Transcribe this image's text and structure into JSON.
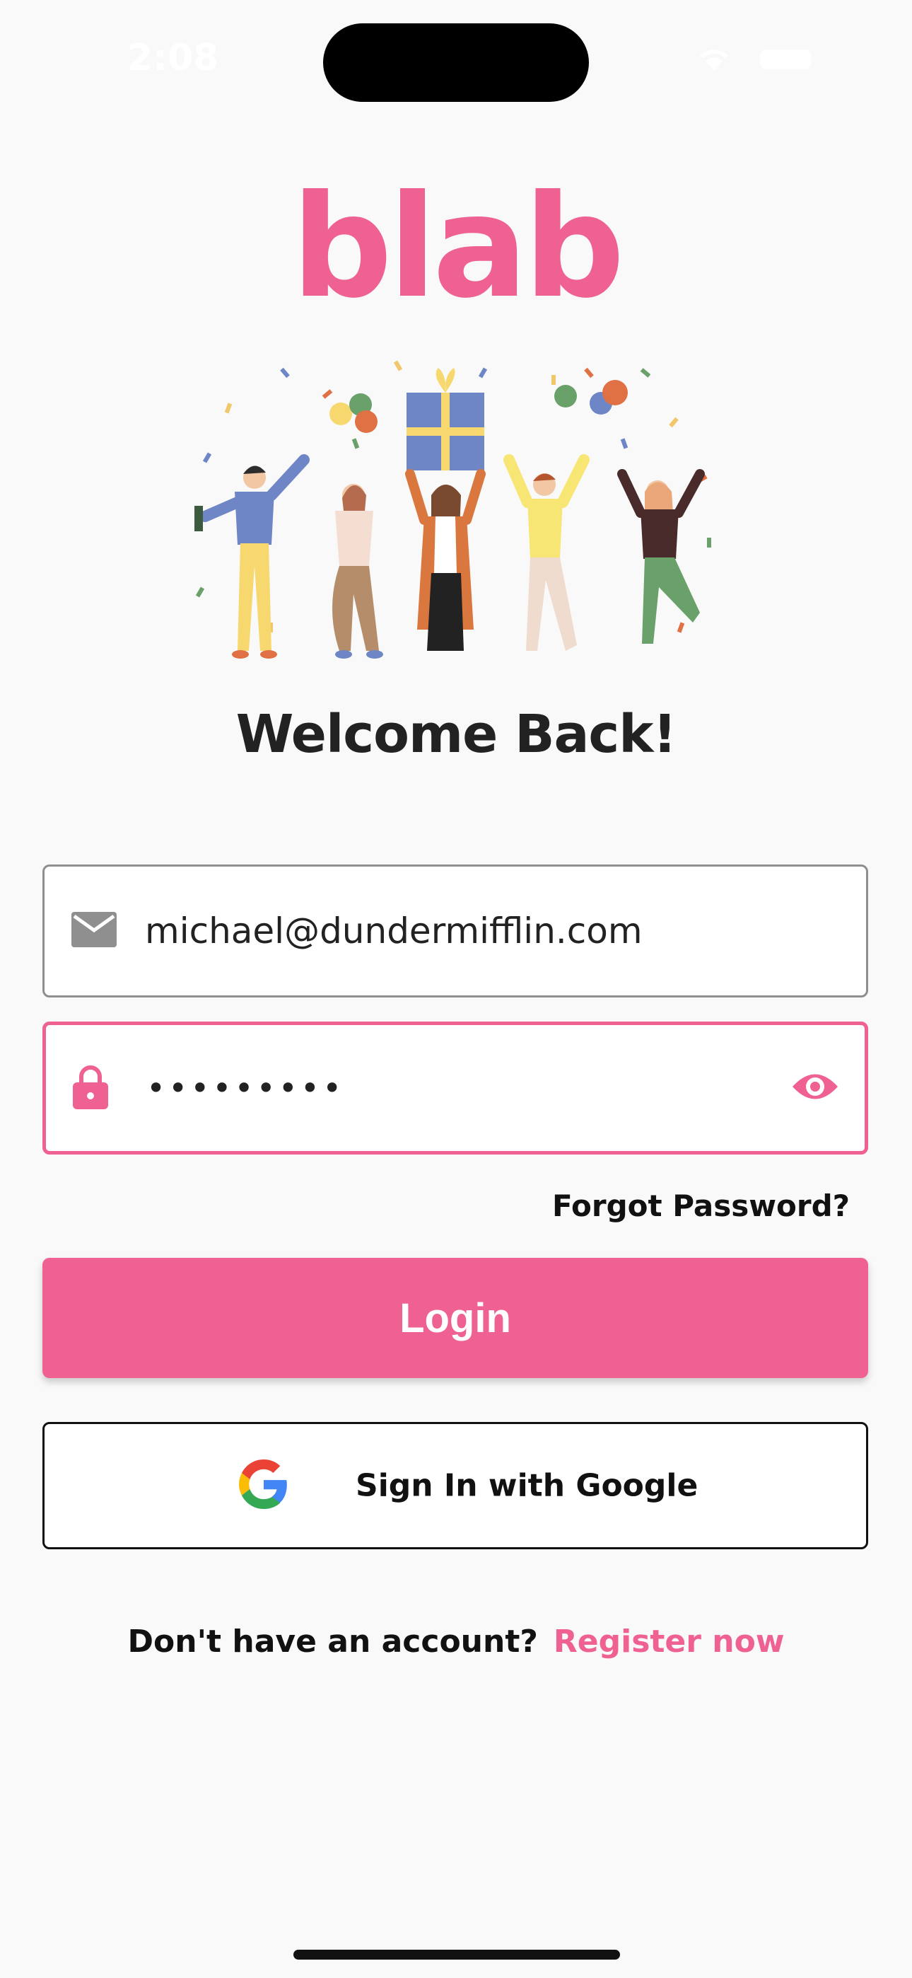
{
  "status_bar": {
    "time": "2:08"
  },
  "brand": {
    "logo_text": "blab",
    "color": "#ef6193"
  },
  "hero": {
    "illustration": "party-people-illustration"
  },
  "headline": "Welcome Back!",
  "email_field": {
    "icon": "mail-icon",
    "value": "michael@dundermifflin.com"
  },
  "password_field": {
    "icon": "lock-icon",
    "value": "•••••••••",
    "toggle_icon": "eye-icon"
  },
  "forgot_password": "Forgot Password?",
  "login_button": "Login",
  "google_button": {
    "label": "Sign In with Google",
    "icon": "google-icon"
  },
  "register": {
    "prompt": "Don't have an account?",
    "link": "Register now"
  }
}
